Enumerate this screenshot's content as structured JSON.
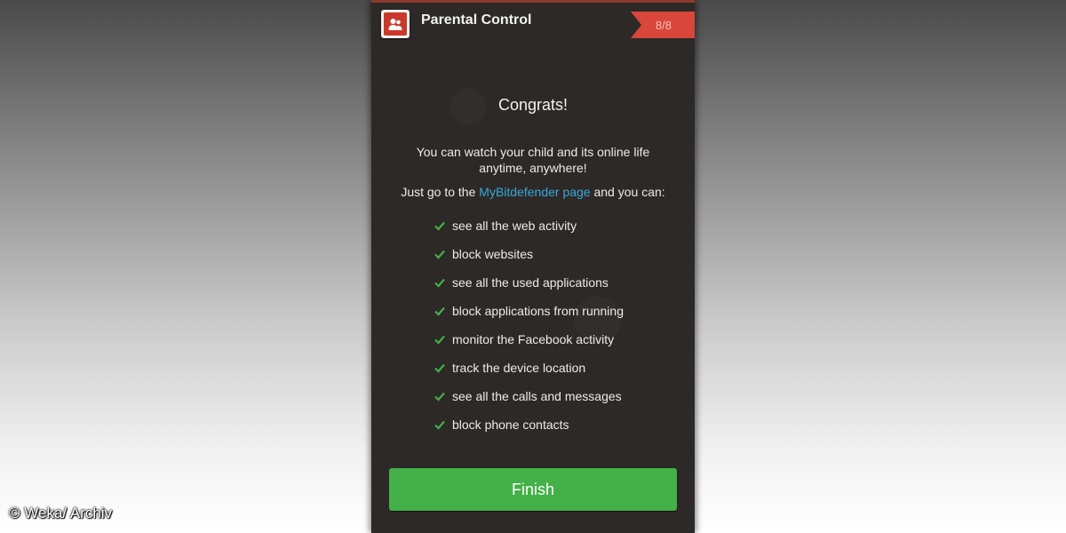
{
  "header": {
    "title": "Parental Control",
    "step": "8/8",
    "icon": "parental-control-app-icon"
  },
  "content": {
    "heading": "Congrats!",
    "intro": "You can watch your child and its online life anytime, anywhere!",
    "goto_prefix": "Just go to the ",
    "goto_link": "MyBitdefender page",
    "goto_suffix": " and you can:",
    "features": [
      "see all the web activity",
      "block websites",
      "see all the used applications",
      "block applications from running",
      "monitor the Facebook activity",
      "track the device location",
      "see all the calls and messages",
      "block phone contacts"
    ]
  },
  "actions": {
    "finish_label": "Finish"
  },
  "credit": "© Weka/ Archiv",
  "colors": {
    "accent_green": "#43b048",
    "ribbon_red": "#d9463a",
    "link_blue": "#3aa8d8",
    "background": "#2c2927"
  }
}
